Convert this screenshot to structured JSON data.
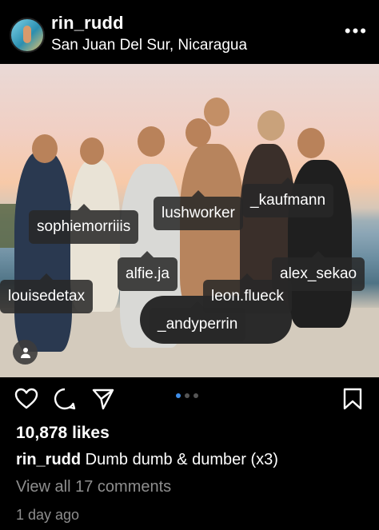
{
  "header": {
    "username": "rin_rudd",
    "location": "San Juan Del Sur, Nicaragua",
    "more_icon": "more-horizontal-icon",
    "more_label": "•••"
  },
  "photo": {
    "tags": [
      {
        "label": "sophiemorriiis"
      },
      {
        "label": "lushworker"
      },
      {
        "label": "_kaufmann"
      },
      {
        "label": "alfie.ja"
      },
      {
        "label": "alex_sekao"
      },
      {
        "label": "louisedetax"
      },
      {
        "label": "leon.flueck"
      },
      {
        "label": "_andyperrin"
      }
    ],
    "tag_indicator_icon": "person-tag-icon"
  },
  "actions": {
    "like_icon": "heart-icon",
    "comment_icon": "comment-icon",
    "share_icon": "send-icon",
    "save_icon": "bookmark-icon",
    "carousel": {
      "count": 3,
      "active": 1
    },
    "accent_color": "#3f8eea"
  },
  "post": {
    "likes": "10,878 likes",
    "caption_user": "rin_rudd",
    "caption_text": " Dumb dumb & dumber (x3)",
    "view_comments": "View all 17 comments",
    "timestamp": "1 day ago"
  }
}
